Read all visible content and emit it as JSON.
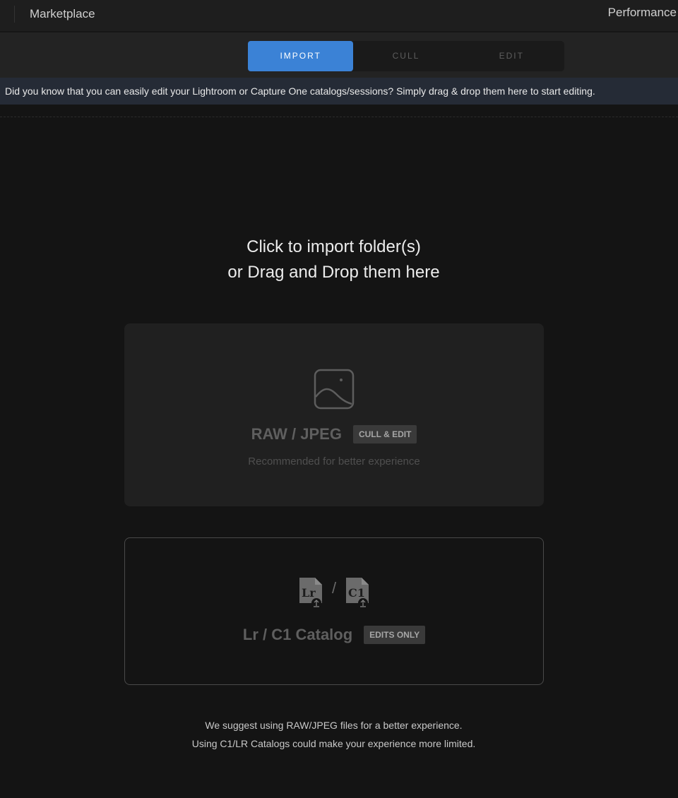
{
  "topbar": {
    "left_label": "Marketplace",
    "right_label": "Performance"
  },
  "tabs": [
    {
      "label": "IMPORT",
      "active": true
    },
    {
      "label": "CULL",
      "active": false
    },
    {
      "label": "EDIT",
      "active": false
    }
  ],
  "banner": {
    "text": "Did you know that you can easily edit your Lightroom or Capture One catalogs/sessions? Simply drag & drop them here to start editing."
  },
  "main": {
    "headline_line1": "Click to import folder(s)",
    "headline_line2": "or Drag and Drop them here"
  },
  "raw_card": {
    "icon": "image-icon",
    "title": "RAW / JPEG",
    "badge": "CULL & EDIT",
    "subtitle": "Recommended for better experience"
  },
  "catalog_card": {
    "icons": [
      "lightroom-file-icon",
      "capture-one-file-icon"
    ],
    "lr_icon_text": "Lr",
    "c1_icon_text": "C1",
    "separator": "/",
    "title": "Lr / C1 Catalog",
    "badge": "EDITS ONLY"
  },
  "footer": {
    "line1": "We suggest using RAW/JPEG files for a better experience.",
    "line2": "Using C1/LR Catalogs could make your experience more limited."
  },
  "colors": {
    "accent": "#3b82d6",
    "background": "#141414",
    "banner_bg": "#252b36"
  }
}
